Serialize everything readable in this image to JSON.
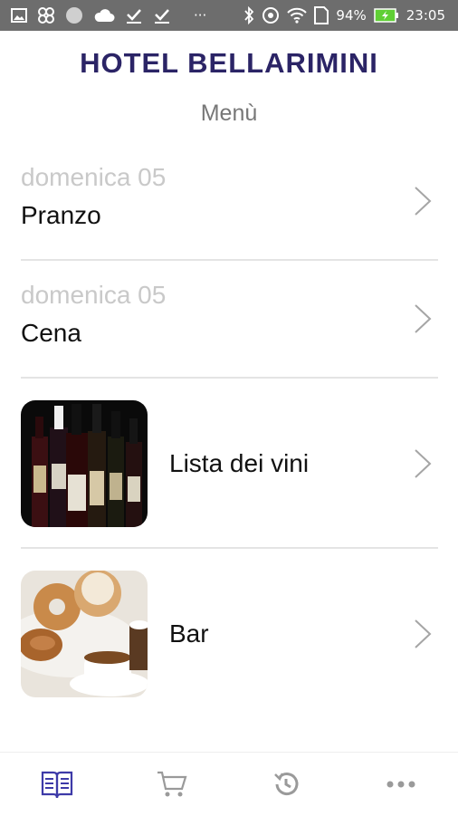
{
  "status_bar": {
    "battery_percent": "94%",
    "time": "23:05",
    "overflow": "···"
  },
  "header": {
    "title": "HOTEL BELLARIMINI",
    "subtitle": "Menù"
  },
  "menu_items": [
    {
      "day": "domenica 05",
      "meal": "Pranzo"
    },
    {
      "day": "domenica 05",
      "meal": "Cena"
    },
    {
      "label": "Lista dei vini",
      "image": "wine-bottles"
    },
    {
      "label": "Bar",
      "image": "coffee-and-donuts"
    }
  ],
  "bottom_nav": {
    "items": [
      "menu-book-icon",
      "cart-icon",
      "history-icon",
      "more-icon"
    ],
    "active_color": "#3d3aa8",
    "inactive_color": "#9a9a9a"
  },
  "colors": {
    "title": "#2b2466",
    "statusbar": "#6d6d6d"
  }
}
